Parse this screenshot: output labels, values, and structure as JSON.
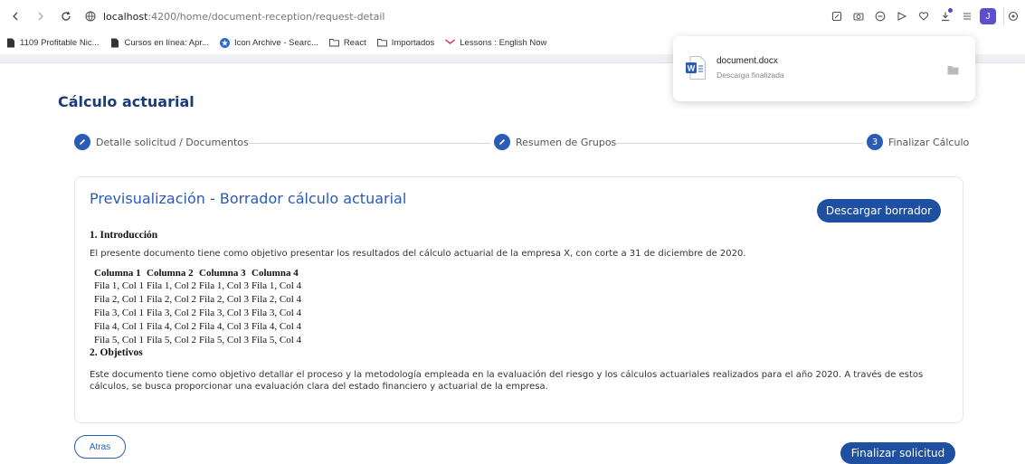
{
  "browser": {
    "url_host": "localhost",
    "url_path": ":4200/home/document-reception/request-detail",
    "avatar_letter": "J",
    "bookmarks": [
      {
        "label": "1109 Profitable Nic..."
      },
      {
        "label": "Cursos en línea: Apr..."
      },
      {
        "label": "Icon Archive - Searc..."
      },
      {
        "label": "React"
      },
      {
        "label": "Importados"
      },
      {
        "label": "Lessons : English Now"
      }
    ]
  },
  "download": {
    "file_name": "document.docx",
    "status": "Descarga finalizada"
  },
  "page": {
    "title": "Cálculo actuarial"
  },
  "stepper": {
    "steps": [
      {
        "label": "Detalle solicitud / Documentos",
        "state": "done"
      },
      {
        "label": "Resumen de Grupos",
        "state": "done"
      },
      {
        "label": "Finalizar Cálculo",
        "state": "current",
        "number": "3"
      }
    ]
  },
  "preview": {
    "title": "Previsualización - Borrador cálculo actuarial",
    "download_button": "Descargar borrador",
    "section1_heading": "1. Introducción",
    "section1_text": "El presente documento tiene como objetivo presentar los resultados del cálculo actuarial de la empresa X, con corte a 31 de diciembre de 2020.",
    "table": {
      "headers": [
        "Columna 1",
        "Columna 2",
        "Columna 3",
        "Columna 4"
      ],
      "rows": [
        [
          "Fila 1, Col 1",
          "Fila 1, Col 2",
          "Fila 1, Col 3",
          "Fila 1, Col 4"
        ],
        [
          "Fila 2, Col 1",
          "Fila 2, Col 2",
          "Fila 2, Col 3",
          "Fila 2, Col 4"
        ],
        [
          "Fila 3, Col 1",
          "Fila 3, Col 2",
          "Fila 3, Col 3",
          "Fila 3, Col 4"
        ],
        [
          "Fila 4, Col 1",
          "Fila 4, Col 2",
          "Fila 4, Col 3",
          "Fila 4, Col 4"
        ],
        [
          "Fila 5, Col 1",
          "Fila 5, Col 2",
          "Fila 5, Col 3",
          "Fila 5, Col 4"
        ]
      ]
    },
    "section2_heading": "2. Objetivos",
    "section2_text": "Este documento tiene como objetivo detallar el proceso y la metodología empleada en la evaluación del riesgo y los cálculos actuariales realizados para el año 2020. A través de estos cálculos, se busca proporcionar una evaluación clara del estado financiero y actuarial de la empresa."
  },
  "actions": {
    "back_button": "Atras",
    "finish_button": "Finalizar solicitud"
  },
  "colors": {
    "primary": "#1f4fa0",
    "title": "#1d3b78",
    "accent": "#2a5bb5"
  },
  "icons": [
    "back-arrow-icon",
    "forward-arrow-icon",
    "reload-icon",
    "site-info-icon",
    "screenshot-icon",
    "camera-icon",
    "shield-icon",
    "send-icon",
    "heart-icon",
    "download-icon",
    "list-icon",
    "extension-icon",
    "word-doc-icon",
    "folder-icon",
    "pencil-icon"
  ]
}
